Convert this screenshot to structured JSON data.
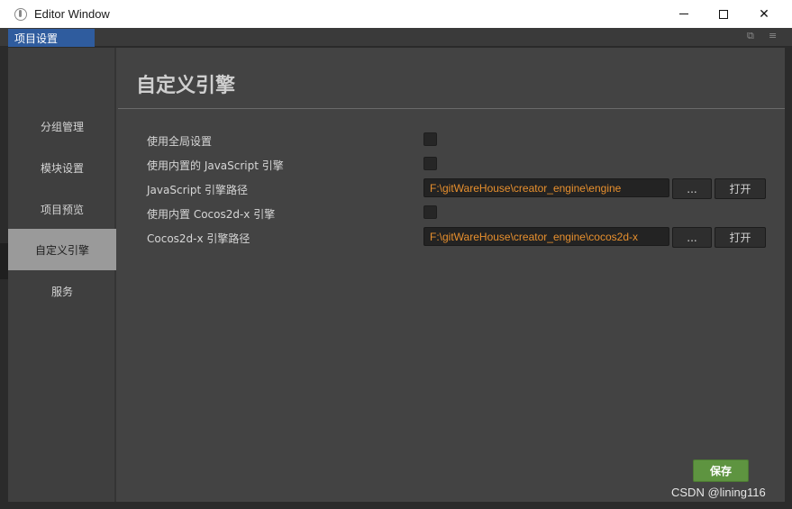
{
  "window": {
    "title": "Editor Window",
    "controls": {
      "minimize": "minimize-icon",
      "maximize": "maximize-icon",
      "close": "✕"
    }
  },
  "tabs": {
    "active_label": "项目设置",
    "restore_glyph": "⧉",
    "menu_glyph": "≡"
  },
  "sidebar": {
    "items": [
      {
        "label": "分组管理",
        "active": false
      },
      {
        "label": "模块设置",
        "active": false
      },
      {
        "label": "项目预览",
        "active": false
      },
      {
        "label": "自定义引擎",
        "active": true
      },
      {
        "label": "服务",
        "active": false
      }
    ]
  },
  "content": {
    "title": "自定义引擎",
    "rows": [
      {
        "label": "使用全局设置",
        "type": "checkbox",
        "checked": false
      },
      {
        "label": "使用内置的 JavaScript 引擎",
        "type": "checkbox",
        "checked": false
      },
      {
        "label": "JavaScript 引擎路径",
        "type": "path",
        "value": "F:\\gitWareHouse\\creator_engine\\engine",
        "browse_label": "...",
        "open_label": "打开"
      },
      {
        "label": "使用内置 Cocos2d-x 引擎",
        "type": "checkbox",
        "checked": false
      },
      {
        "label": "Cocos2d-x 引擎路径",
        "type": "path",
        "value": "F:\\gitWareHouse\\creator_engine\\cocos2d-x",
        "browse_label": "...",
        "open_label": "打开"
      }
    ],
    "save_label": "保存"
  },
  "watermark": "CSDN @lining116",
  "colors": {
    "accent_tab": "#2f5c9e",
    "path_text": "#e8902e",
    "save_button": "#5e9440",
    "sidebar_active": "#9a9a9a"
  }
}
